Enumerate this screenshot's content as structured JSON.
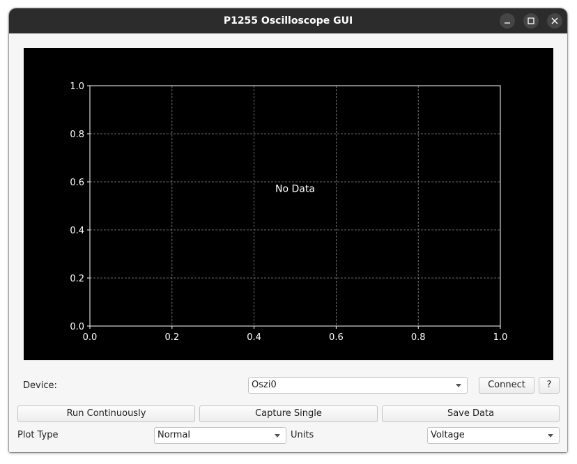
{
  "window": {
    "title": "P1255 Oscilloscope GUI",
    "controls": {
      "minimize": "minimize-icon",
      "maximize": "maximize-icon",
      "close": "close-icon"
    }
  },
  "chart_data": {
    "type": "line",
    "series": [],
    "annotation": "No Data",
    "xlim": [
      0.0,
      1.0
    ],
    "ylim": [
      0.0,
      1.0
    ],
    "xticks": [
      "0.0",
      "0.2",
      "0.4",
      "0.6",
      "0.8",
      "1.0"
    ],
    "yticks": [
      "0.0",
      "0.2",
      "0.4",
      "0.6",
      "0.8",
      "1.0"
    ],
    "grid": true,
    "background": "#000000",
    "foreground": "#ffffff"
  },
  "device": {
    "label": "Device:",
    "selected": "Oszi0",
    "connect_label": "Connect",
    "help_label": "?"
  },
  "actions": {
    "run_continuously": "Run Continuously",
    "capture_single": "Capture Single",
    "save_data": "Save Data"
  },
  "settings": {
    "plot_type_label": "Plot Type",
    "plot_type_selected": "Normal",
    "units_label": "Units",
    "units_selected": "Voltage"
  },
  "colors": {
    "titlebar": "#2c2c2c",
    "window_bg": "#f6f6f6",
    "plot_bg": "#000000"
  }
}
